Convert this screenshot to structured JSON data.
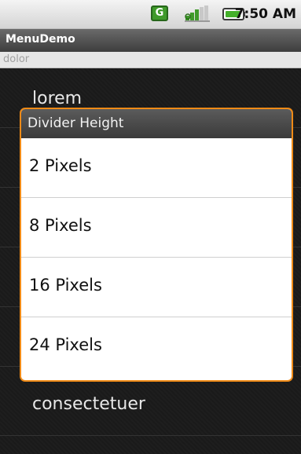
{
  "status_bar": {
    "g_icon": "G",
    "time": "7:50 AM",
    "icons": [
      "g-notification-icon",
      "signal-icon",
      "battery-icon"
    ]
  },
  "app": {
    "title": "MenuDemo"
  },
  "edit_field": {
    "value": "dolor"
  },
  "list": {
    "items": [
      {
        "label": "lorem"
      },
      {
        "label": "consectetuer"
      }
    ]
  },
  "dialog": {
    "title": "Divider Height",
    "options": [
      {
        "label": "2 Pixels"
      },
      {
        "label": "8 Pixels"
      },
      {
        "label": "16 Pixels"
      },
      {
        "label": "24 Pixels"
      }
    ]
  },
  "colors": {
    "accent": "#ef8a16",
    "list_background": "#1a1a1a",
    "battery": "#44b02a"
  }
}
